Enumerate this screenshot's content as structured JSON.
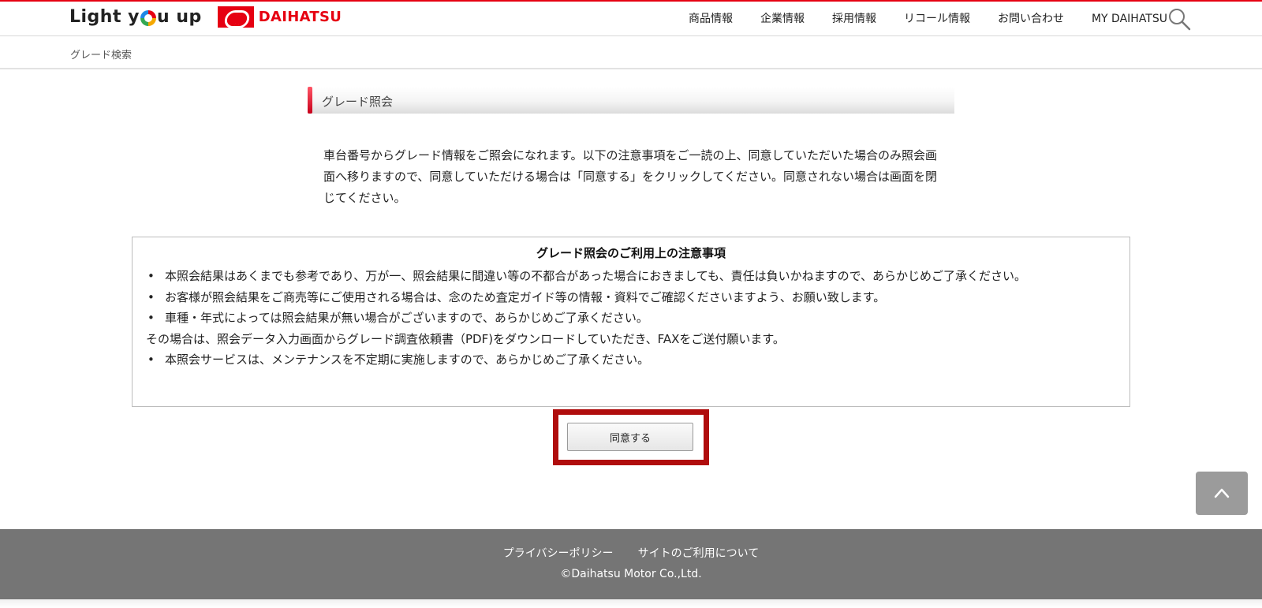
{
  "header": {
    "tagline_part1": "Light y",
    "tagline_part2": "u up",
    "brand_name": "DAIHATSU",
    "nav": [
      "商品情報",
      "企業情報",
      "採用情報",
      "リコール情報",
      "お問い合わせ",
      "MY DAIHATSU"
    ]
  },
  "breadcrumb": {
    "current": "グレード検索"
  },
  "section": {
    "title": "グレード照会"
  },
  "intro": {
    "text": "車台番号からグレード情報をご照会になれます。以下の注意事項をご一読の上、同意していただいた場合のみ照会画面へ移りますので、同意していただける場合は「同意する」をクリックしてください。同意されない場合は画面を閉じてください。"
  },
  "notice": {
    "title": "グレード照会のご利用上の注意事項",
    "item1": "本照会結果はあくまでも参考であり、万が一、照会結果に間違い等の不都合があった場合におきましても、責任は負いかねますので、あらかじめご了承ください。",
    "item2": "お客様が照会結果をご商売等にご使用される場合は、念のため査定ガイド等の情報・資料でご確認くださいますよう、お願い致します。",
    "item3": "車種・年式によっては照会結果が無い場合がございますので、あらかじめご了承ください。",
    "note": "その場合は、照会データ入力画面からグレード調査依頼書（PDF)をダウンロードしていただき、FAXをご送付願います。",
    "item4": "本照会サービスは、メンテナンスを不定期に実施しますので、あらかじめご了承ください。"
  },
  "actions": {
    "agree_label": "同意する"
  },
  "footer": {
    "links": [
      "プライバシーポリシー",
      "サイトのご利用について"
    ],
    "copyright": "©Daihatsu Motor Co.,Ltd."
  },
  "colors": {
    "brand_red": "#e60012",
    "highlight_frame": "#b00d0d",
    "footer_bg": "#757575"
  },
  "icons": {
    "search": "search-icon",
    "scroll_top": "chevron-up-icon"
  }
}
